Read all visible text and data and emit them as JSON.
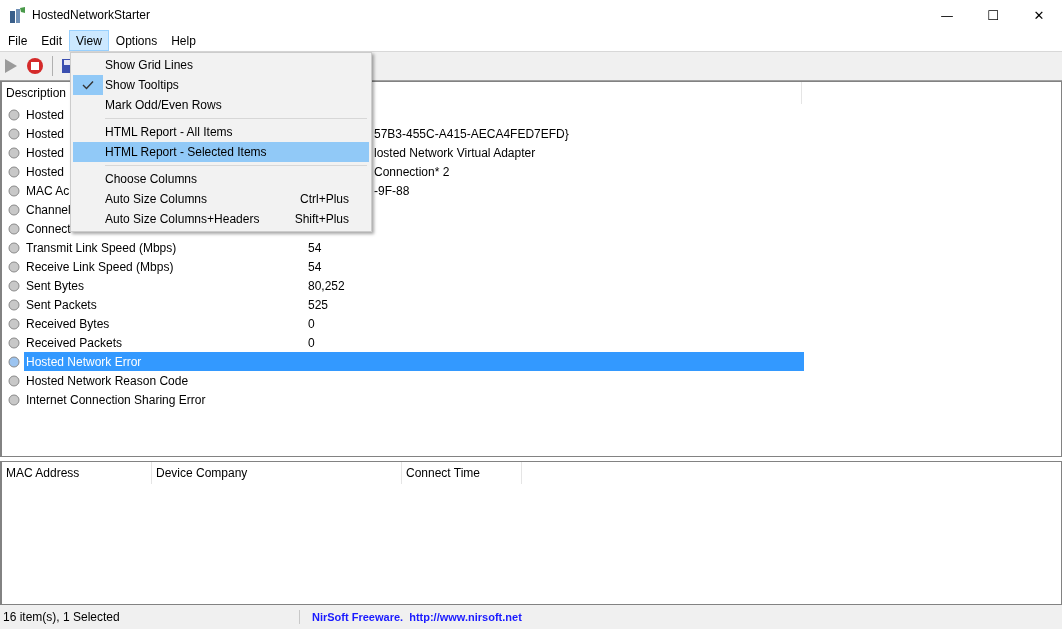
{
  "window": {
    "title": "HostedNetworkStarter",
    "controls": [
      "—",
      "☐",
      "✕"
    ]
  },
  "menubar": [
    {
      "label": "File",
      "selected": false
    },
    {
      "label": "Edit",
      "selected": false
    },
    {
      "label": "View",
      "selected": true
    },
    {
      "label": "Options",
      "selected": false
    },
    {
      "label": "Help",
      "selected": false
    }
  ],
  "main_table": {
    "columns": [
      "Description"
    ],
    "rows": [
      {
        "description": "Hosted",
        "value": "",
        "selected": false
      },
      {
        "description": "Hosted",
        "value": "57B3-455C-A415-AECA4FED7EFD}",
        "selected": false
      },
      {
        "description": "Hosted",
        "value": "losted Network Virtual Adapter",
        "selected": false
      },
      {
        "description": "Hosted",
        "value": "Connection* 2",
        "selected": false
      },
      {
        "description": "MAC Ac",
        "value": "-9F-88",
        "selected": false
      },
      {
        "description": "Channel",
        "value": "",
        "selected": false
      },
      {
        "description": "Connect",
        "value": "",
        "selected": false
      },
      {
        "description": "Transmit Link Speed (Mbps)",
        "value": "54",
        "selected": false
      },
      {
        "description": "Receive Link Speed (Mbps)",
        "value": "54",
        "selected": false
      },
      {
        "description": "Sent Bytes",
        "value": "80,252",
        "selected": false
      },
      {
        "description": "Sent Packets",
        "value": "525",
        "selected": false
      },
      {
        "description": "Received Bytes",
        "value": "0",
        "selected": false
      },
      {
        "description": "Received Packets",
        "value": "0",
        "selected": false
      },
      {
        "description": "Hosted Network Error",
        "value": "",
        "selected": true
      },
      {
        "description": "Hosted Network Reason Code",
        "value": "",
        "selected": false
      },
      {
        "description": "Internet Connection Sharing Error",
        "value": "",
        "selected": false
      }
    ]
  },
  "view_menu": [
    {
      "kind": "item",
      "label": "Show Grid Lines",
      "checked": false,
      "selected": false
    },
    {
      "kind": "item",
      "label": "Show Tooltips",
      "checked": true,
      "selected": false
    },
    {
      "kind": "item",
      "label": "Mark Odd/Even Rows",
      "checked": false,
      "selected": false
    },
    {
      "kind": "separator"
    },
    {
      "kind": "item",
      "label": "HTML Report - All Items",
      "checked": false,
      "selected": false
    },
    {
      "kind": "item",
      "label": "HTML Report - Selected Items",
      "checked": false,
      "selected": true
    },
    {
      "kind": "separator"
    },
    {
      "kind": "item",
      "label": "Choose Columns",
      "checked": false,
      "selected": false
    },
    {
      "kind": "item",
      "label": "Auto Size Columns",
      "shortcut": "Ctrl+Plus",
      "checked": false,
      "selected": false
    },
    {
      "kind": "item",
      "label": "Auto Size Columns+Headers",
      "shortcut": "Shift+Plus",
      "checked": false,
      "selected": false
    }
  ],
  "clients_table": {
    "columns": [
      "MAC Address",
      "Device Company",
      "Connect Time"
    ]
  },
  "status_bar": {
    "count": "16 item(s), 1 Selected",
    "link": "NirSoft Freeware.  http://www.nirsoft.net"
  }
}
